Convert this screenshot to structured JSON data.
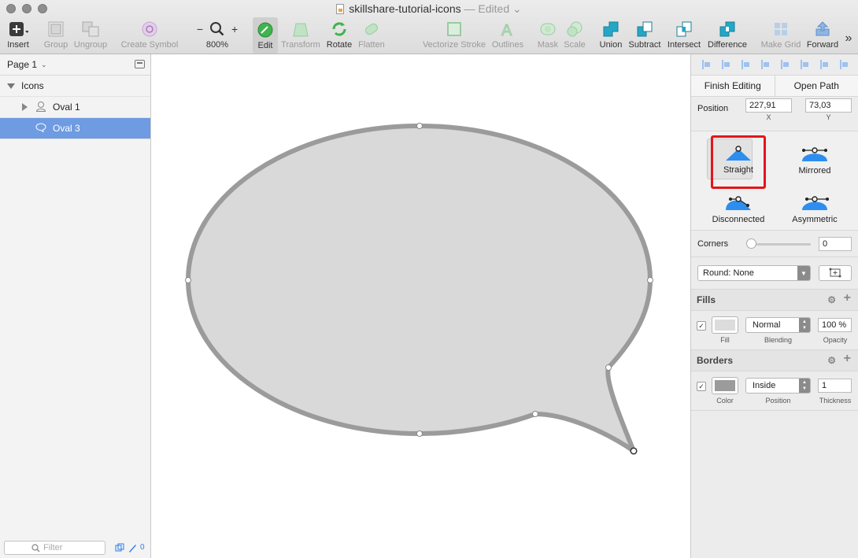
{
  "window": {
    "title": "skillshare-tutorial-icons",
    "edited": "— Edited ⌄"
  },
  "toolbar": {
    "insert": "Insert",
    "group": "Group",
    "ungroup": "Ungroup",
    "create_symbol": "Create Symbol",
    "zoom_minus": "−",
    "zoom_plus": "+",
    "zoom": "800%",
    "edit": "Edit",
    "transform": "Transform",
    "rotate": "Rotate",
    "flatten": "Flatten",
    "vectorize_stroke": "Vectorize Stroke",
    "outlines": "Outlines",
    "mask": "Mask",
    "scale": "Scale",
    "union": "Union",
    "subtract": "Subtract",
    "intersect": "Intersect",
    "difference": "Difference",
    "make_grid": "Make Grid",
    "forward": "Forward",
    "more": "»"
  },
  "sidebar": {
    "page": "Page 1",
    "page_chevron": "⌄",
    "layers": [
      {
        "label": "Icons"
      },
      {
        "label": "Oval 1"
      },
      {
        "label": "Oval 3"
      }
    ],
    "filter_placeholder": "Filter",
    "filter_count": "0"
  },
  "inspector": {
    "finish_editing": "Finish Editing",
    "open_path": "Open Path",
    "position_label": "Position",
    "x_value": "227,91",
    "y_value": "73,03",
    "x_label": "X",
    "y_label": "Y",
    "point_types": [
      "Straight",
      "Mirrored",
      "Disconnected",
      "Asymmetric"
    ],
    "corners_label": "Corners",
    "corners_value": "0",
    "corners_slider_fraction": 0,
    "round_option": "Round: None",
    "fills_heading": "Fills",
    "fill_label": "Fill",
    "fill_blending": "Normal",
    "blending_label": "Blending",
    "fill_opacity": "100 %",
    "opacity_label": "Opacity",
    "borders_heading": "Borders",
    "color_label": "Color",
    "border_position": "Inside",
    "position_sub_label": "Position",
    "border_thickness": "1",
    "thickness_label": "Thickness"
  },
  "colors": {
    "selection": "#6e9be2",
    "accent": "#2b7de9",
    "highlight": "#e3161b",
    "shape_fill": "#d9d9d9",
    "shape_stroke": "#9b9b9b",
    "fill_swatch": "#dcdcdc",
    "border_swatch": "#9b9b9b"
  }
}
